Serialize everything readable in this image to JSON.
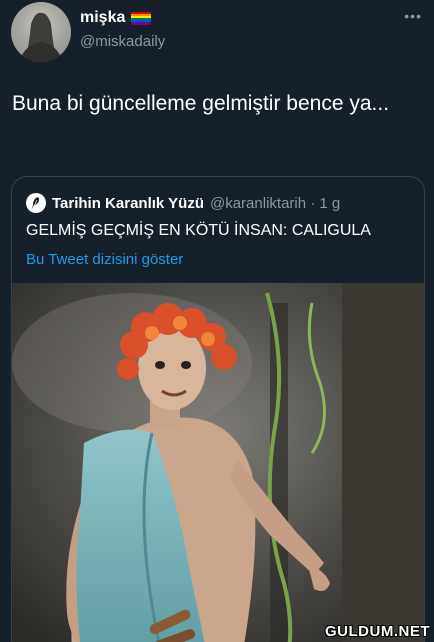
{
  "author": {
    "display_name": "mişka",
    "handle": "@miskadaily",
    "badge_icon": "rainbow-flag-icon",
    "avatar_icon": "silhouette-avatar"
  },
  "more_icon": "more-horizontal-icon",
  "tweet": {
    "text": "Buna bi güncelleme gelmiştir bence ya..."
  },
  "quoted_tweet": {
    "display_name": "Tarihin Karanlık Yüzü",
    "handle_time": "@karanliktarih · 1 g",
    "avatar_icon": "feather-logo-icon",
    "text": "GELMİŞ GEÇMİŞ EN KÖTÜ İNSAN: CALIGULA",
    "thread_link": "Bu Tweet dizisini göster",
    "media_icon": "caligula-actor-photo"
  },
  "watermark": "GULDUM.NET",
  "colors": {
    "background": "#15202b",
    "secondary_text": "#8b98a5",
    "link": "#1d9bf0",
    "border": "#38444d"
  }
}
